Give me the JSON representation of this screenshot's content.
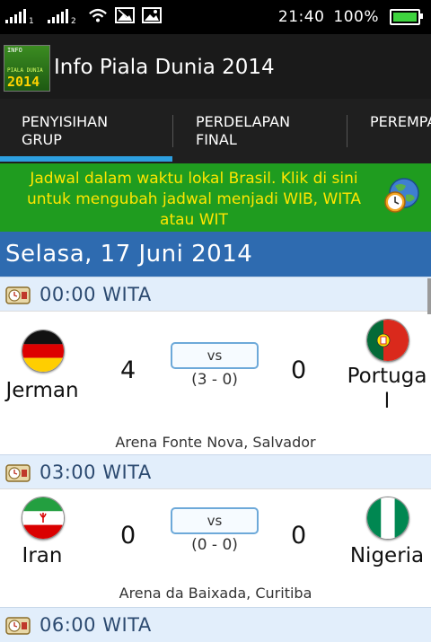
{
  "status_bar": {
    "sim_labels": [
      "1",
      "2"
    ],
    "time": "21:40",
    "battery": "100%",
    "battery_level": 1.0,
    "icons": [
      "signal-icon",
      "wifi-icon",
      "image-notification-icon",
      "gallery-notification-icon",
      "battery-icon"
    ]
  },
  "app": {
    "title": "Info Piala Dunia 2014",
    "logo_text": {
      "top": "INFO",
      "middle": "PIALA DUNIA",
      "year": "2014"
    }
  },
  "tabs": [
    {
      "line1": "PENYISIHAN",
      "line2": "GRUP",
      "selected": true
    },
    {
      "line1": "PERDELAPAN",
      "line2": "FINAL",
      "selected": false
    },
    {
      "line1": "PEREMPA",
      "line2": "",
      "selected": false
    }
  ],
  "notice": {
    "text": "Jadwal dalam waktu lokal Brasil. Klik di sini untuk mengubah jadwal menjadi WIB, WITA atau WIT",
    "icon": "globe-clock-icon"
  },
  "date_header": "Selasa, 17 Juni 2014",
  "colors": {
    "accent_tab": "#2d9fe0",
    "notice_bg": "#1f9c1f",
    "notice_text": "#ffe600",
    "date_bg": "#2e6bb0",
    "time_bg": "#e2eefb"
  },
  "matches": [
    {
      "time": "00:00 WITA",
      "home": {
        "name": "Jerman",
        "flag": "germany-flag-icon",
        "score": "4"
      },
      "away": {
        "name_line1": "Portuga",
        "name_line2": "l",
        "flag": "portugal-flag-icon",
        "score": "0"
      },
      "vs": "vs",
      "halftime": "(3 - 0)",
      "venue": "Arena Fonte Nova, Salvador"
    },
    {
      "time": "03:00 WITA",
      "home": {
        "name": "Iran",
        "flag": "iran-flag-icon",
        "score": "0"
      },
      "away": {
        "name_line1": "Nigeria",
        "name_line2": "",
        "flag": "nigeria-flag-icon",
        "score": "0"
      },
      "vs": "vs",
      "halftime": "(0 - 0)",
      "venue": "Arena da Baixada, Curitiba"
    },
    {
      "time": "06:00 WITA"
    }
  ]
}
